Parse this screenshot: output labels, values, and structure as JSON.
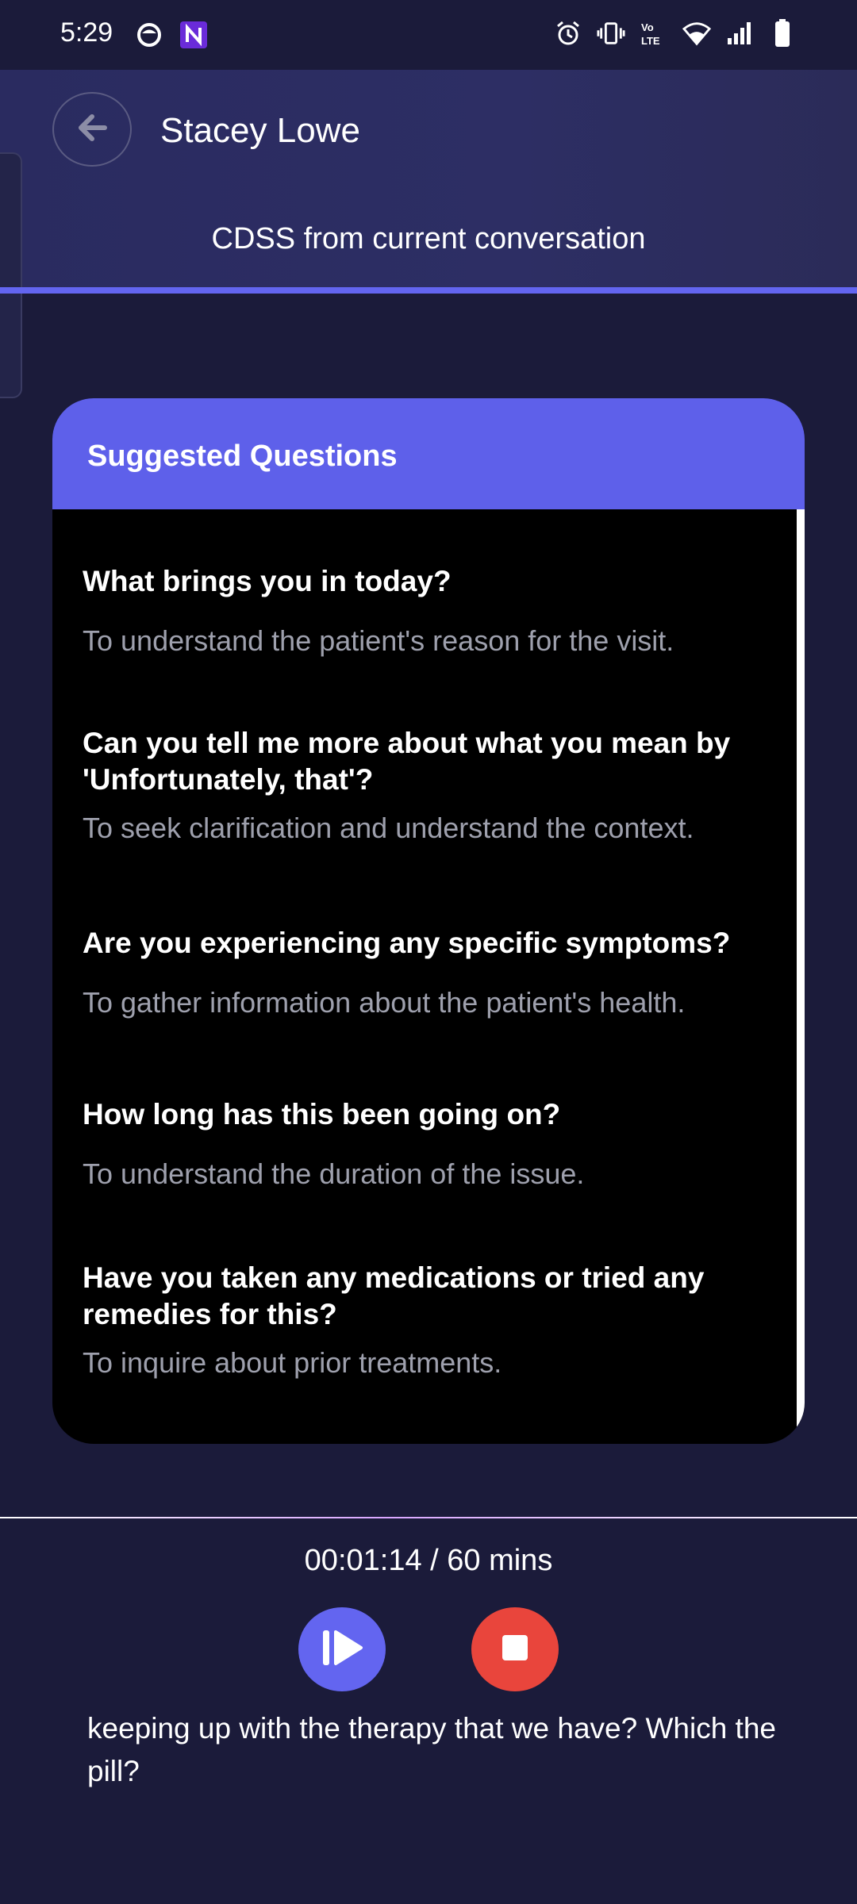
{
  "status_bar": {
    "time": "5:29",
    "left_icons": [
      "face-icon",
      "n-app-icon"
    ],
    "right_icons": [
      "alarm-icon",
      "vibrate-icon",
      "volte-icon",
      "wifi-icon",
      "signal-icon",
      "battery-icon"
    ]
  },
  "header": {
    "title": "Stacey Lowe",
    "subtitle": "CDSS from current conversation",
    "back_icon": "arrow-left-icon"
  },
  "card": {
    "title": "Suggested Questions",
    "questions": [
      {
        "question": "What brings you in today?",
        "reason": "To understand the patient's reason for the visit."
      },
      {
        "question": "Can you tell me more about what you mean by 'Unfortunately, that'?",
        "reason": "To seek clarification and understand the context."
      },
      {
        "question": "Are you experiencing any specific symptoms?",
        "reason": "To gather information about the patient's health."
      },
      {
        "question": "How long has this been going on?",
        "reason": "To understand the duration of the issue."
      },
      {
        "question": "Have you taken any medications or tried any remedies for this?",
        "reason": "To inquire about prior treatments."
      }
    ]
  },
  "controls": {
    "timer": "00:01:14 / 60 mins",
    "resume_icon": "resume-icon",
    "stop_icon": "stop-icon"
  },
  "transcript": {
    "text": "keeping up with the therapy that we have? Which the pill?"
  },
  "colors": {
    "background": "#1b1b3a",
    "accent": "#6365f0",
    "stop": "#e9453c"
  }
}
